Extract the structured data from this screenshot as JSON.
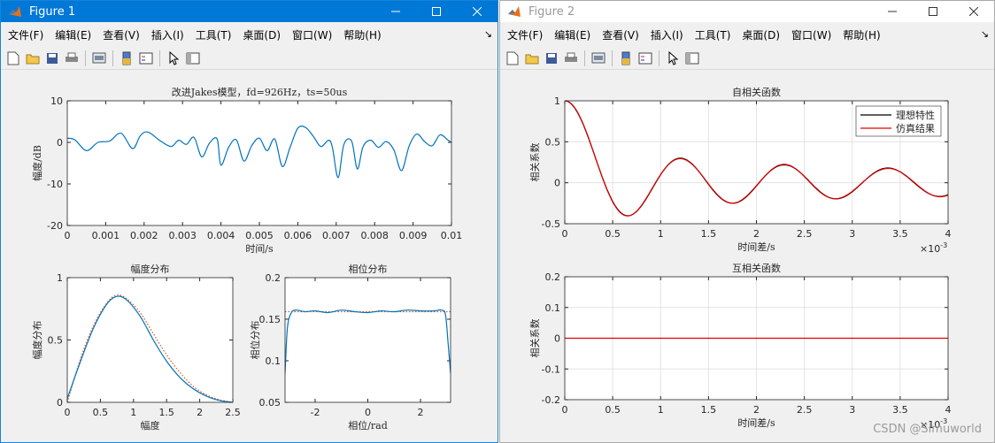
{
  "figure1": {
    "title": "Figure 1",
    "menus": [
      "文件(F)",
      "编辑(E)",
      "查看(V)",
      "插入(I)",
      "工具(T)",
      "桌面(D)",
      "窗口(W)",
      "帮助(H)"
    ]
  },
  "figure2": {
    "title": "Figure 2",
    "menus": [
      "文件(F)",
      "编辑(E)",
      "查看(V)",
      "插入(I)",
      "工具(T)",
      "桌面(D)",
      "窗口(W)",
      "帮助(H)"
    ]
  },
  "toolbar_icons": [
    "new-figure-icon",
    "open-file-icon",
    "save-icon",
    "print-icon",
    "print-preview-icon",
    "link-plot-icon",
    "insert-colorbar-icon",
    "insert-legend-icon",
    "pointer-icon",
    "property-inspector-icon"
  ],
  "watermark": "CSDN @Simuworld",
  "chart_data": [
    {
      "id": "envelope",
      "type": "line",
      "title": "改进Jakes模型，fd=926Hz，ts=50us",
      "xlabel": "时间/s",
      "ylabel": "幅度/dB",
      "xlim": [
        0,
        0.01
      ],
      "ylim": [
        -20,
        10
      ],
      "xticks": [
        "0",
        "0.001",
        "0.002",
        "0.003",
        "0.004",
        "0.005",
        "0.006",
        "0.007",
        "0.008",
        "0.009",
        "0.01"
      ],
      "yticks": [
        "-20",
        "-10",
        "0",
        "10"
      ],
      "color": "#0072bd",
      "series": [
        {
          "x": [
            0,
            0.0002,
            0.0005,
            0.0008,
            0.0011,
            0.0014,
            0.0017,
            0.0019,
            0.0021,
            0.0024,
            0.0027,
            0.0029,
            0.0031,
            0.0033,
            0.0035,
            0.0037,
            0.0039,
            0.004,
            0.0042,
            0.0044,
            0.0046,
            0.0048,
            0.005,
            0.0052,
            0.0054,
            0.0056,
            0.0058,
            0.006,
            0.0062,
            0.0064,
            0.0066,
            0.0068,
            0.0069,
            0.00705,
            0.0072,
            0.0074,
            0.00755,
            0.0077,
            0.0079,
            0.0081,
            0.0083,
            0.0085,
            0.0087,
            0.0089,
            0.0091,
            0.0093,
            0.0095,
            0.0097,
            0.0099,
            0.01
          ],
          "y": [
            1,
            0.6,
            -2,
            0,
            0.3,
            2.2,
            -1.5,
            1.6,
            2.5,
            0.5,
            -1,
            0.5,
            -0.5,
            1.2,
            -3.5,
            -0.2,
            0.8,
            -5.5,
            -1.2,
            0.6,
            -4.5,
            -0.8,
            1.0,
            -2.0,
            0.8,
            -5.8,
            -1.2,
            3.4,
            3.6,
            1.5,
            -1.0,
            0.5,
            -1.2,
            -8.5,
            -0.5,
            0.3,
            -6.4,
            -1.0,
            0.5,
            -1.2,
            0.2,
            -1.8,
            -6.8,
            -0.8,
            2.0,
            0.2,
            -0.8,
            1.8,
            0.6,
            0
          ]
        }
      ]
    },
    {
      "id": "amplitude",
      "type": "line",
      "title": "幅度分布",
      "xlabel": "幅度",
      "ylabel": "幅度分布",
      "xlim": [
        0,
        2.5
      ],
      "ylim": [
        0,
        1
      ],
      "xticks": [
        "0",
        "0.5",
        "1",
        "1.5",
        "2",
        "2.5"
      ],
      "yticks": [
        "0",
        "0.5",
        "1"
      ],
      "series": [
        {
          "style": "dotted",
          "color": "#d95319",
          "x": [
            0,
            0.2,
            0.4,
            0.6,
            0.75,
            0.9,
            1.1,
            1.3,
            1.5,
            1.7,
            1.9,
            2.1,
            2.3,
            2.5
          ],
          "y": [
            0,
            0.35,
            0.62,
            0.8,
            0.86,
            0.83,
            0.72,
            0.55,
            0.38,
            0.24,
            0.13,
            0.06,
            0.02,
            0.0
          ]
        },
        {
          "style": "solid",
          "color": "#0072bd",
          "x": [
            0,
            0.2,
            0.4,
            0.6,
            0.75,
            0.9,
            1.1,
            1.3,
            1.5,
            1.7,
            1.9,
            2.1,
            2.3,
            2.5
          ],
          "y": [
            0.03,
            0.33,
            0.6,
            0.79,
            0.85,
            0.82,
            0.69,
            0.5,
            0.33,
            0.2,
            0.11,
            0.05,
            0.015,
            0.0
          ]
        }
      ]
    },
    {
      "id": "phase",
      "type": "line",
      "title": "相位分布",
      "xlabel": "相位/rad",
      "ylabel": "相位分布",
      "xlim": [
        -3.1416,
        3.1416
      ],
      "ylim": [
        0.05,
        0.2
      ],
      "xticks": [
        "-2",
        "0",
        "2"
      ],
      "xtick_values": [
        -2,
        0,
        2
      ],
      "yticks": [
        "0.05",
        "0.1",
        "0.15",
        "0.2"
      ],
      "series": [
        {
          "style": "dotted",
          "color": "#d95319",
          "x": [
            -3.1416,
            3.1416
          ],
          "y": [
            0.159,
            0.159
          ]
        },
        {
          "style": "solid",
          "color": "#0072bd",
          "x": [
            -3.1416,
            -3.05,
            -2.9,
            -2.7,
            -2.4,
            -2.0,
            -1.5,
            -1.0,
            -0.5,
            0,
            0.5,
            1.0,
            1.5,
            2.0,
            2.5,
            2.8,
            2.95,
            3.05,
            3.1416
          ],
          "y": [
            0.085,
            0.14,
            0.158,
            0.161,
            0.159,
            0.16,
            0.158,
            0.161,
            0.159,
            0.158,
            0.16,
            0.159,
            0.161,
            0.16,
            0.16,
            0.161,
            0.155,
            0.12,
            0.085
          ]
        }
      ]
    },
    {
      "id": "autocorr",
      "type": "line",
      "title": "自相关函数",
      "xlabel": "时间差/s",
      "ylabel": "相关系数",
      "xlim": [
        0,
        4
      ],
      "ylim": [
        -0.5,
        1
      ],
      "exponent": "×10-3",
      "xticks": [
        "0",
        "0.5",
        "1",
        "1.5",
        "2",
        "2.5",
        "3",
        "3.5",
        "4"
      ],
      "yticks": [
        "-0.5",
        "0",
        "0.5",
        "1"
      ],
      "grid": true,
      "legend": {
        "position": "top-right",
        "entries": [
          {
            "label": "理想特性",
            "color": "#000000"
          },
          {
            "label": "仿真结果",
            "color": "#e00000"
          }
        ]
      },
      "series": [
        {
          "name": "理想特性",
          "color": "#000000",
          "fn": "bessel0",
          "fd": 926
        },
        {
          "name": "仿真结果",
          "color": "#e00000",
          "fn": "bessel0",
          "fd": 926
        }
      ]
    },
    {
      "id": "crosscorr",
      "type": "line",
      "title": "互相关函数",
      "xlabel": "时间差/s",
      "ylabel": "相关系数",
      "xlim": [
        0,
        4
      ],
      "ylim": [
        -0.2,
        0.2
      ],
      "exponent": "×10-3",
      "xticks": [
        "0",
        "0.5",
        "1",
        "1.5",
        "2",
        "2.5",
        "3",
        "3.5",
        "4"
      ],
      "yticks": [
        "-0.2",
        "-0.1",
        "0",
        "0.1",
        "0.2"
      ],
      "grid": true,
      "series": [
        {
          "color": "#e00000",
          "x": [
            0,
            4
          ],
          "y": [
            0,
            0
          ]
        }
      ]
    }
  ]
}
